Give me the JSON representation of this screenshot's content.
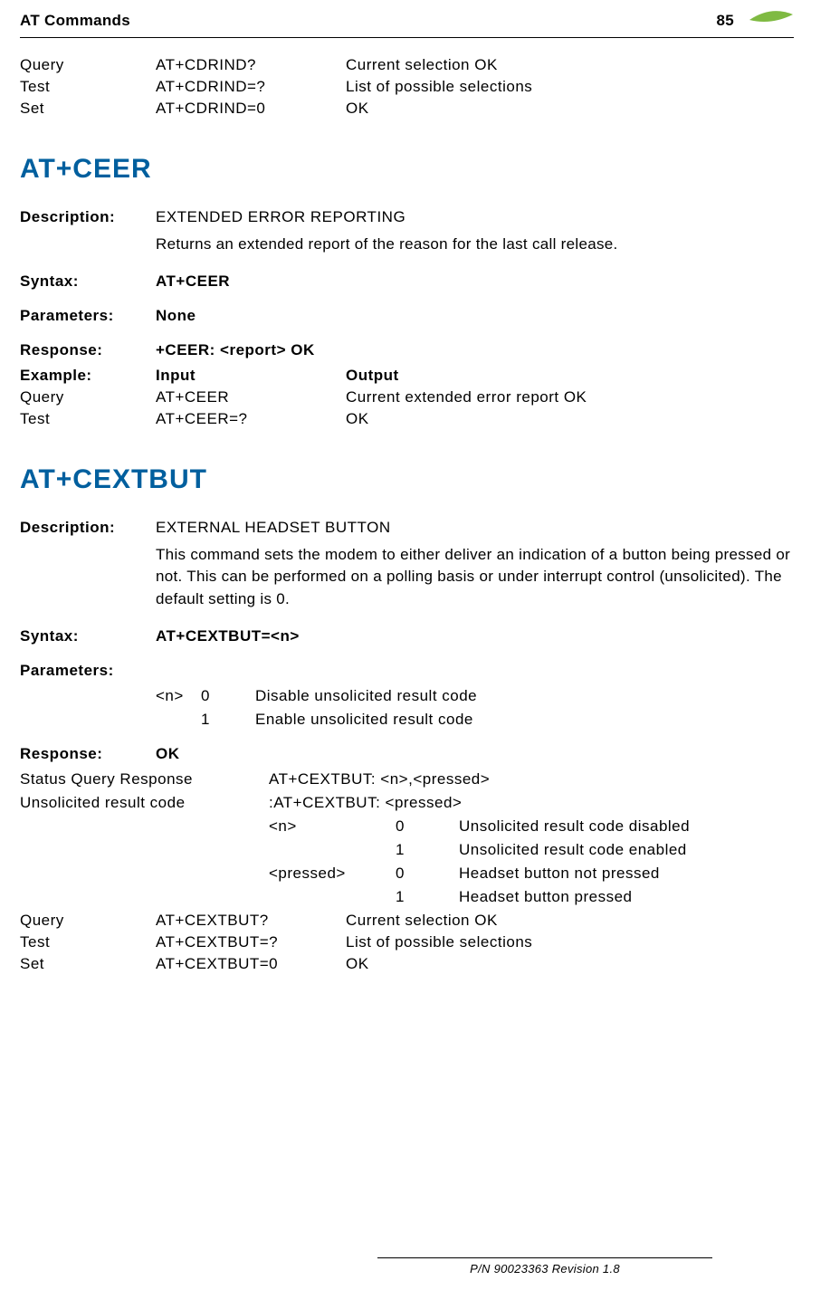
{
  "header": {
    "title": "AT Commands",
    "page": "85"
  },
  "top_table": [
    {
      "type": "Query",
      "cmd": "AT+CDRIND?",
      "resp": "Current selection OK"
    },
    {
      "type": "Test",
      "cmd": "AT+CDRIND=?",
      "resp": "List of possible selections"
    },
    {
      "type": "Set",
      "cmd": "AT+CDRIND=0",
      "resp": "OK"
    }
  ],
  "ceer": {
    "heading": "AT+CEER",
    "description_label": "Description:",
    "description_name": "EXTENDED ERROR REPORTING",
    "description_text": "Returns an extended report of the reason for the last call release.",
    "syntax_label": "Syntax:",
    "syntax_value": "AT+CEER",
    "parameters_label": "Parameters:",
    "parameters_value": "None",
    "response_label": "Response:",
    "response_value": "+CEER: <report> OK",
    "example_label": "Example:",
    "example_input": "Input",
    "example_output": "Output",
    "examples": [
      {
        "type": "Query",
        "cmd": "AT+CEER",
        "resp": "Current extended error report OK"
      },
      {
        "type": "Test",
        "cmd": "AT+CEER=?",
        "resp": "OK"
      }
    ]
  },
  "cextbut": {
    "heading": "AT+CEXTBUT",
    "description_label": "Description:",
    "description_name": "EXTERNAL HEADSET BUTTON",
    "description_text": "This command sets the modem to either deliver an indication of a button being pressed or not. This can be performed on a polling basis or under interrupt control (unsolicited). The default setting is 0.",
    "syntax_label": "Syntax:",
    "syntax_value": "AT+CEXTBUT=<n>",
    "parameters_label": "Parameters:",
    "param_name": "<n>",
    "param_rows": [
      {
        "val": "0",
        "desc": "Disable unsolicited result code"
      },
      {
        "val": "1",
        "desc": "Enable unsolicited result code"
      }
    ],
    "response_label": "Response:",
    "response_value": "OK",
    "status_query_label": "Status Query Response",
    "status_query_value": "AT+CEXTBUT: <n>,<pressed>",
    "unsolicited_label": "Unsolicited result code",
    "unsolicited_value": ":AT+CEXTBUT: <pressed>",
    "sub": {
      "n_label": "<n>",
      "n_rows": [
        {
          "val": "0",
          "desc": "Unsolicited result code disabled"
        },
        {
          "val": "1",
          "desc": "Unsolicited result code enabled"
        }
      ],
      "pressed_label": "<pressed>",
      "pressed_rows": [
        {
          "val": "0",
          "desc": "Headset button not pressed"
        },
        {
          "val": "1",
          "desc": "Headset button pressed"
        }
      ]
    },
    "bottom_table": [
      {
        "type": "Query",
        "cmd": "AT+CEXTBUT?",
        "resp": "Current selection OK"
      },
      {
        "type": "Test",
        "cmd": "AT+CEXTBUT=?",
        "resp": "List of possible selections"
      },
      {
        "type": "Set",
        "cmd": "AT+CEXTBUT=0",
        "resp": "OK"
      }
    ]
  },
  "footer": "P/N 90023363  Revision 1.8"
}
